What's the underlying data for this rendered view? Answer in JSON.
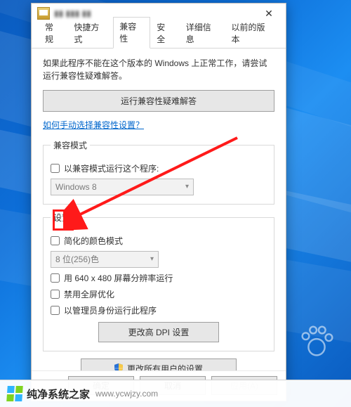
{
  "window": {
    "title": "▮▮ ▮▮▮ ▮▮",
    "close_glyph": "✕"
  },
  "tabs": [
    {
      "label": "常规"
    },
    {
      "label": "快捷方式"
    },
    {
      "label": "兼容性"
    },
    {
      "label": "安全"
    },
    {
      "label": "详细信息"
    },
    {
      "label": "以前的版本"
    }
  ],
  "intro_text": "如果此程序不能在这个版本的 Windows 上正常工作，请尝试运行兼容性疑难解答。",
  "troubleshoot_button": "运行兼容性疑难解答",
  "manual_link": "如何手动选择兼容性设置？",
  "compat_mode": {
    "legend": "兼容模式",
    "checkbox_label": "以兼容模式运行这个程序:",
    "select_value": "Windows 8"
  },
  "settings": {
    "legend": "设置",
    "reduced_color_label": "简化的颜色模式",
    "color_select_value": "8 位(256)色",
    "run_640_label": "用 640 x 480 屏幕分辨率运行",
    "disable_fullscreen_label": "禁用全屏优化",
    "run_as_admin_label": "以管理员身份运行此程序",
    "dpi_button": "更改高 DPI 设置"
  },
  "all_users_button": "更改所有用户的设置",
  "footer": {
    "ok": "确定",
    "cancel": "取消",
    "apply": "应用(A)"
  },
  "watermark": {
    "brand": "纯净系统之家",
    "url": "www.ycwjzy.com"
  }
}
